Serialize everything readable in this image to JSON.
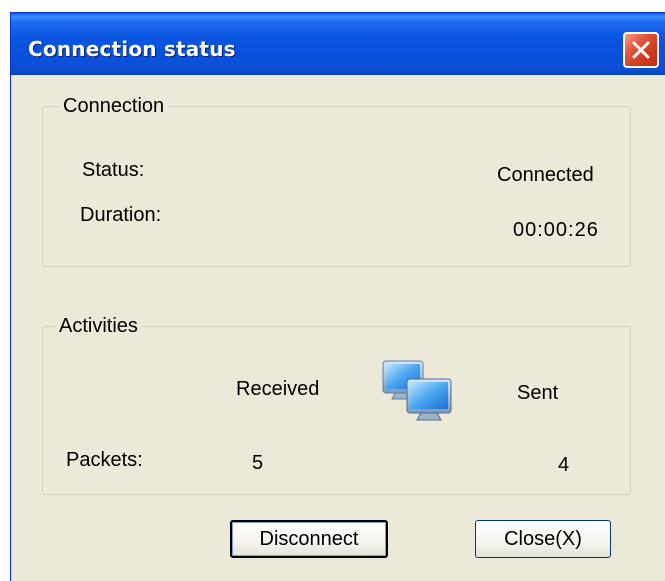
{
  "window": {
    "title": "Connection status",
    "close_glyph": "×"
  },
  "connection": {
    "legend": "Connection",
    "status_label": "Status:",
    "status_value": "Connected",
    "duration_label": "Duration:",
    "duration_value": "00:00:26"
  },
  "activities": {
    "legend": "Activities",
    "received_header": "Received",
    "sent_header": "Sent",
    "packets_label": "Packets:",
    "packets_received": "5",
    "packets_sent": "4",
    "icon": "network-computers-icon"
  },
  "buttons": {
    "disconnect_label": "Disconnect",
    "close_label": "Close(X)"
  },
  "colors": {
    "titlebar": "#0a50dc",
    "close_button": "#d0391c",
    "dialog_bg": "#ece9d8"
  }
}
